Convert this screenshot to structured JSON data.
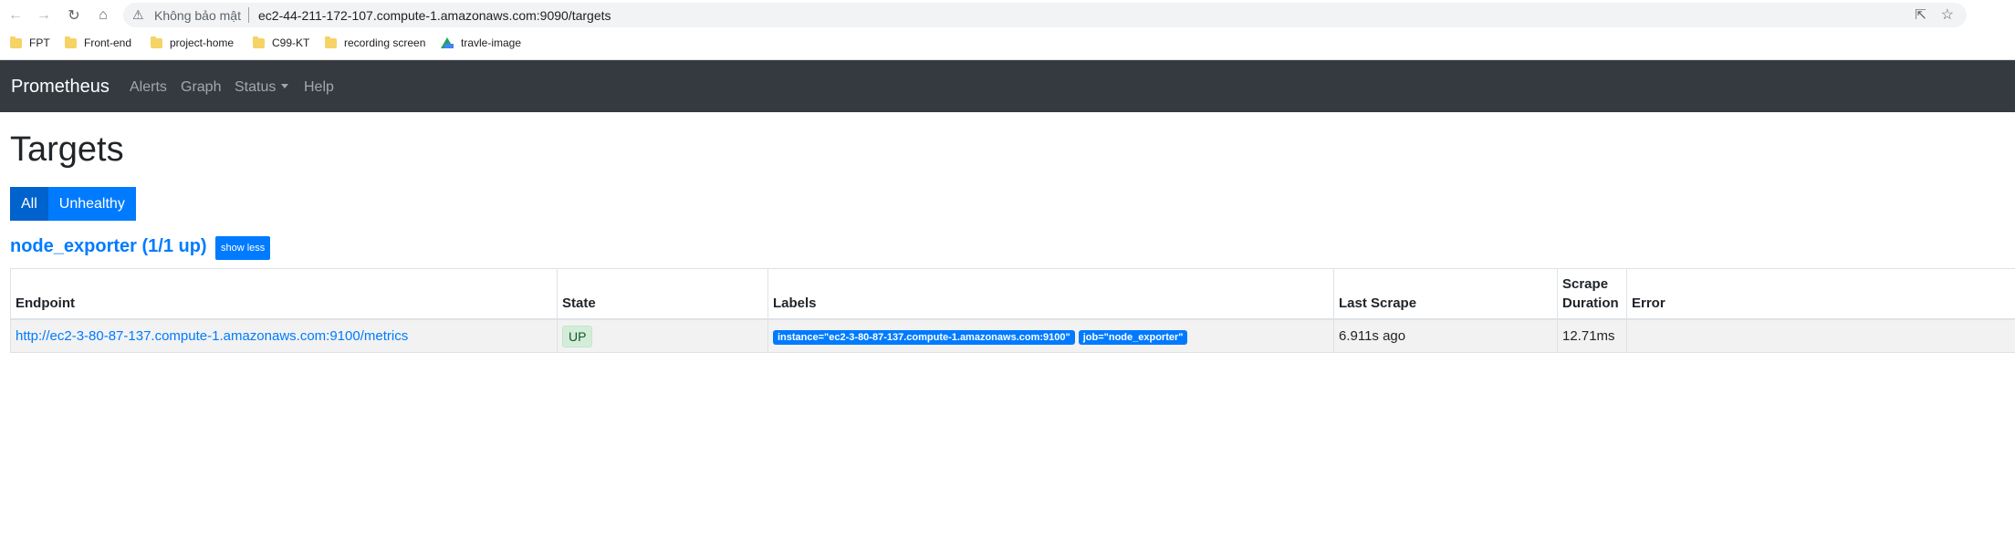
{
  "browser": {
    "not_secure": "Không bảo mật",
    "url": "ec2-44-211-172-107.compute-1.amazonaws.com:9090/targets",
    "bookmarks": [
      {
        "label": "FPT",
        "icon": "folder-icon"
      },
      {
        "label": "Front-end",
        "icon": "folder-icon"
      },
      {
        "label": "project-home",
        "icon": "folder-icon"
      },
      {
        "label": "C99-KT",
        "icon": "folder-icon"
      },
      {
        "label": "recording screen",
        "icon": "folder-icon"
      },
      {
        "label": "travle-image",
        "icon": "google-drive-icon"
      }
    ]
  },
  "navbar": {
    "brand": "Prometheus",
    "links": [
      "Alerts",
      "Graph",
      "Status",
      "Help"
    ]
  },
  "page": {
    "title": "Targets",
    "filters": [
      "All",
      "Unhealthy"
    ],
    "active_filter": "All"
  },
  "job": {
    "header": "node_exporter (1/1 up)",
    "toggle_label": "show less",
    "columns": [
      "Endpoint",
      "State",
      "Labels",
      "Last Scrape",
      "Scrape Duration",
      "Error"
    ],
    "rows": [
      {
        "endpoint": "http://ec2-3-80-87-137.compute-1.amazonaws.com:9100/metrics",
        "state": "UP",
        "labels": [
          "instance=\"ec2-3-80-87-137.compute-1.amazonaws.com:9100\"",
          "job=\"node_exporter\""
        ],
        "last_scrape": "6.911s ago",
        "scrape_duration": "12.71ms",
        "error": ""
      }
    ]
  },
  "colors": {
    "navbar_bg": "#343a40",
    "primary": "#007bff",
    "up_badge_bg": "#d4edda",
    "up_badge_text": "#155724"
  }
}
